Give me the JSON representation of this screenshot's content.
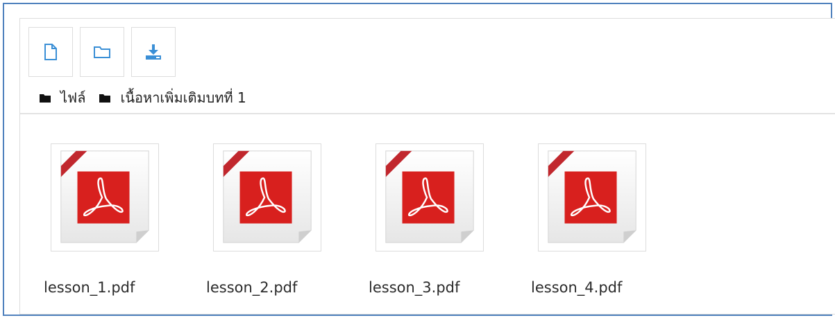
{
  "toolbar": {
    "buttons": [
      {
        "icon": "file-icon"
      },
      {
        "icon": "folder-icon"
      },
      {
        "icon": "download-icon"
      }
    ],
    "icon_color": "#3a8fd6"
  },
  "breadcrumb": [
    {
      "label": "ไฟล์",
      "icon": "folder-icon"
    },
    {
      "label": "เนื้อหาเพิ่มเติมบทที่ 1",
      "icon": "folder-icon"
    }
  ],
  "files": [
    {
      "name": "lesson_1.pdf",
      "type": "pdf"
    },
    {
      "name": "lesson_2.pdf",
      "type": "pdf"
    },
    {
      "name": "lesson_3.pdf",
      "type": "pdf"
    },
    {
      "name": "lesson_4.pdf",
      "type": "pdf"
    }
  ],
  "colors": {
    "frame": "#4f81bd",
    "pdf_red": "#d8201e",
    "pdf_ribbon": "#c1272d"
  }
}
